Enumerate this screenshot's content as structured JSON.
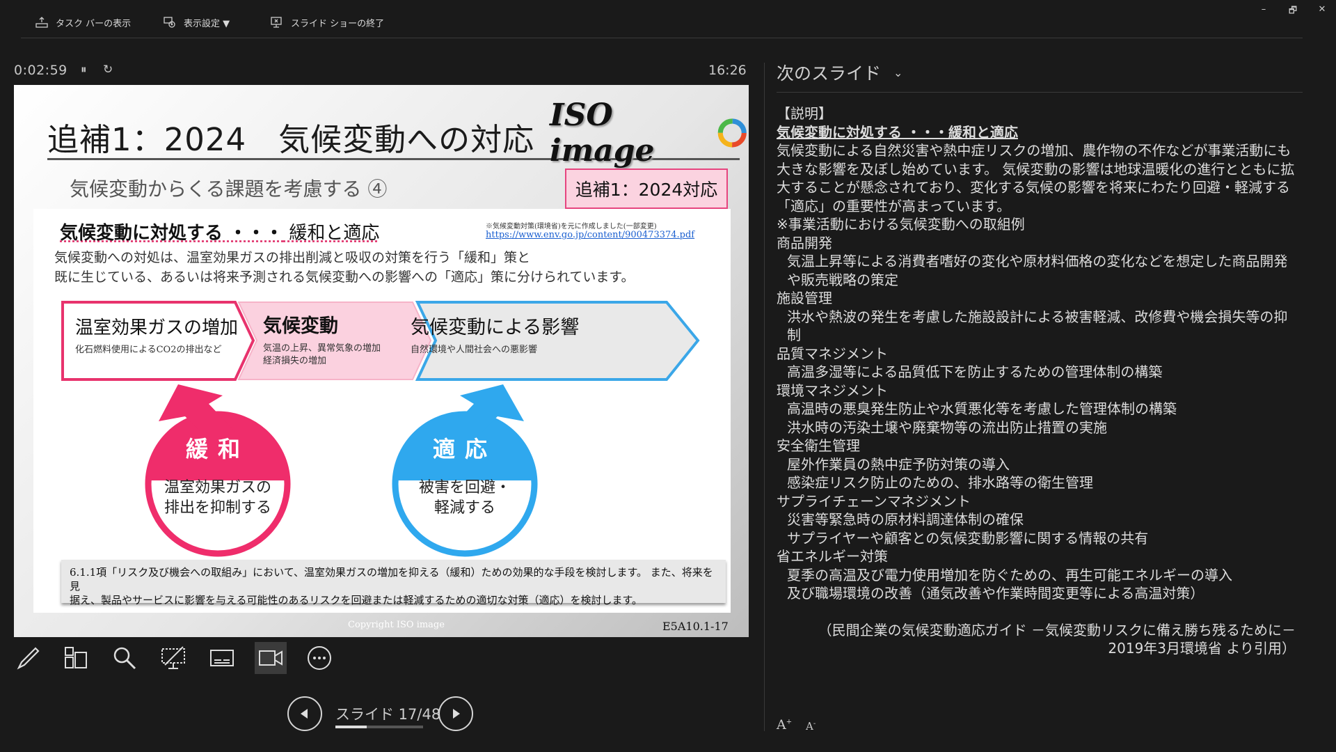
{
  "toolbar": {
    "taskbar": "タスク バーの表示",
    "display_settings": "表示設定 ▼",
    "end_show": "スライド ショーの終了"
  },
  "window_controls": {
    "minimize": "–",
    "restore": "🗗",
    "close": "✕"
  },
  "presenter": {
    "timer": "0:02:59",
    "pause_icon": "⏸",
    "reset_icon": "↻",
    "clock": "16:26",
    "slide_label": "スライド 17/48",
    "progress_fraction": 0.354,
    "tools": [
      "pen-tool",
      "see-all-slides",
      "zoom-into-slide",
      "black-screen",
      "toggle-subtitles",
      "camera",
      "more-options"
    ]
  },
  "slide": {
    "title": "追補1：2024　気候変動への対応",
    "logo": "ISO image",
    "subtitle": "気候変動からくる課題を考慮する ④",
    "badge": "追補1：2024対応",
    "panel_heading_bold": "気候変動に対処する ・・・",
    "panel_heading_rest": " 緩和と適応",
    "source_note": "※気候変動対策(環境省)を元に作成しました(一部変更)",
    "source_link": "https://www.env.go.jp/content/900473374.pdf",
    "body_line1": "気候変動への対処は、温室効果ガスの排出削減と吸収の対策を行う「緩和」策と",
    "body_line2": "既に生じている、あるいは将来予測される気候変動への影響への「適応」策に分けられています。",
    "flow": [
      {
        "title": "温室効果ガスの増加",
        "desc1": "化石燃料使用によるCO2の排出など",
        "desc2": "",
        "color": "#e8336d"
      },
      {
        "title": "気候変動",
        "desc1": "気温の上昇、異常気象の増加",
        "desc2": "経済損失の増加",
        "color": "#f6b3c8"
      },
      {
        "title": "気候変動による影響",
        "desc1": "自然環境や人間社会への悪影響",
        "desc2": "",
        "color": "#3ba7e8"
      }
    ],
    "mitigation": {
      "title": "緩和",
      "line1": "温室効果ガスの",
      "line2": "排出を抑制する",
      "color": "#ef2d6b"
    },
    "adaptation": {
      "title": "適応",
      "line1": "被害を回避・",
      "line2": "軽減する",
      "color": "#2fa8ee"
    },
    "footer_line1": "6.1.1項「リスク及び機会への取組み」において、温室効果ガスの増加を抑える（緩和）ための効果的な手段を検討します。 また、将来を見",
    "footer_line2": "据え、製品やサービスに影響を与える可能性のあるリスクを回避または軽減するための適切な対策（適応）を検討します。",
    "copyright": "Copyright  ISO image",
    "code": "E5A10.1-17"
  },
  "notes_pane": {
    "header": "次のスライド",
    "dropdown_icon": "⌄",
    "lines": [
      {
        "t": "【説明】",
        "s": ""
      },
      {
        "t": "気候変動に対処する ・・・緩和と適応",
        "s": "b"
      },
      {
        "t": "気候変動による自然災害や熱中症リスクの増加、農作物の不作などが事業活動にも大きな影響を及ぼし始めています。 気候変動の影響は地球温暖化の進行とともに拡大することが懸念されており、変化する気候の影響を将来にわたり回避・軽減する「適応」の重要性が高まっています。",
        "s": ""
      },
      {
        "t": " ",
        "s": ""
      },
      {
        "t": "※事業活動における気候変動への取組例",
        "s": ""
      },
      {
        "t": "商品開発",
        "s": ""
      },
      {
        "t": "気温上昇等による消費者嗜好の変化や原材料価格の変化などを想定した商品開発や販売戦略の策定",
        "s": "ind"
      },
      {
        "t": "施設管理",
        "s": ""
      },
      {
        "t": "洪水や熱波の発生を考慮した施設設計による被害軽減、改修費や機会損失等の抑制",
        "s": "ind"
      },
      {
        "t": "品質マネジメント",
        "s": ""
      },
      {
        "t": "高温多湿等による品質低下を防止するための管理体制の構築",
        "s": "ind"
      },
      {
        "t": "環境マネジメント",
        "s": ""
      },
      {
        "t": "高温時の悪臭発生防止や水質悪化等を考慮した管理体制の構築",
        "s": "ind"
      },
      {
        "t": "洪水時の汚染土壌や廃棄物等の流出防止措置の実施",
        "s": "ind"
      },
      {
        "t": "安全衛生管理",
        "s": ""
      },
      {
        "t": "屋外作業員の熱中症予防対策の導入",
        "s": "ind"
      },
      {
        "t": "感染症リスク防止のための、排水路等の衛生管理",
        "s": "ind"
      },
      {
        "t": "サプライチェーンマネジメント",
        "s": ""
      },
      {
        "t": "災害等緊急時の原材料調達体制の確保",
        "s": "ind"
      },
      {
        "t": "サプライヤーや顧客との気候変動影響に関する情報の共有",
        "s": "ind"
      },
      {
        "t": "省エネルギー対策",
        "s": ""
      },
      {
        "t": "夏季の高温及び電力使用増加を防ぐための、再生可能エネルギーの導入",
        "s": "ind"
      },
      {
        "t": "及び職場環境の改善（通気改善や作業時間変更等による高温対策）",
        "s": "ind"
      },
      {
        "t": "（民間企業の気候変動適応ガイド －気候変動リスクに備え勝ち残るために－ 2019年3月環境省 より引用）",
        "s": "cite"
      }
    ],
    "font_increase": "A",
    "font_decrease": "A"
  }
}
